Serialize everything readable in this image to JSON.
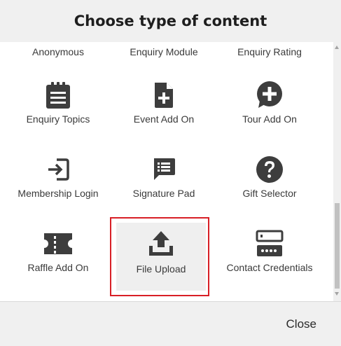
{
  "dialog": {
    "title": "Choose type of content",
    "close_label": "Close"
  },
  "items_partial": [
    {
      "label": "Anonymous"
    },
    {
      "label": "Enquiry Module"
    },
    {
      "label": "Enquiry Rating"
    }
  ],
  "items": [
    {
      "label": "Enquiry Topics",
      "icon": "clipboard-list-icon"
    },
    {
      "label": "Event Add On",
      "icon": "file-plus-icon"
    },
    {
      "label": "Tour Add On",
      "icon": "chat-plus-icon"
    },
    {
      "label": "Membership Login",
      "icon": "login-arrow-icon"
    },
    {
      "label": "Signature Pad",
      "icon": "message-lines-icon"
    },
    {
      "label": "Gift Selector",
      "icon": "question-circle-icon"
    },
    {
      "label": "Raffle Add On",
      "icon": "ticket-icon"
    },
    {
      "label": "File Upload",
      "icon": "upload-icon",
      "selected": true
    },
    {
      "label": "Contact Credentials",
      "icon": "credentials-form-icon"
    }
  ],
  "colors": {
    "icon": "#3d3d3d",
    "highlight": "#d81f26",
    "header_bg": "#f0f0f0"
  }
}
